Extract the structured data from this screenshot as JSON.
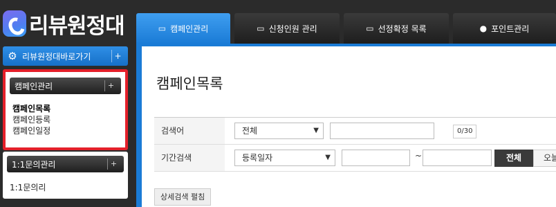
{
  "logo": {
    "text": "리뷰원정대"
  },
  "sidebar": {
    "shortcut_label": "리뷰원정대바로가기",
    "shortcut_plus": "+",
    "panels": [
      {
        "title": "캠페인관리",
        "plus": "+",
        "items": [
          "캠페인목록",
          "캠페인등록",
          "캠페인일정"
        ]
      },
      {
        "title": "1:1문의관리",
        "plus": "+",
        "items": [
          "1:1문의리"
        ]
      }
    ]
  },
  "tabs": [
    {
      "label": "캠페인관리",
      "icon": "inbox-icon"
    },
    {
      "label": "신청인원 관리",
      "icon": "inbox-icon"
    },
    {
      "label": "선정확정 목록",
      "icon": "inbox-icon"
    },
    {
      "label": "포인트관리",
      "icon": "user-icon"
    }
  ],
  "main": {
    "title": "캠페인목록",
    "search": {
      "keyword_label": "검색어",
      "keyword_select": "전체",
      "keyword_value": "",
      "keyword_counter": "0/30",
      "period_label": "기간검색",
      "period_select": "등록일자",
      "period_start": "",
      "period_sep": "~",
      "period_end": "",
      "btn_all": "전체",
      "btn_today": "오늘"
    },
    "detail_toggle": "상세검색 펼침"
  },
  "colors": {
    "accent": "#1a7bd6",
    "highlight": "#e4202a",
    "dark": "#2b2b2b"
  }
}
